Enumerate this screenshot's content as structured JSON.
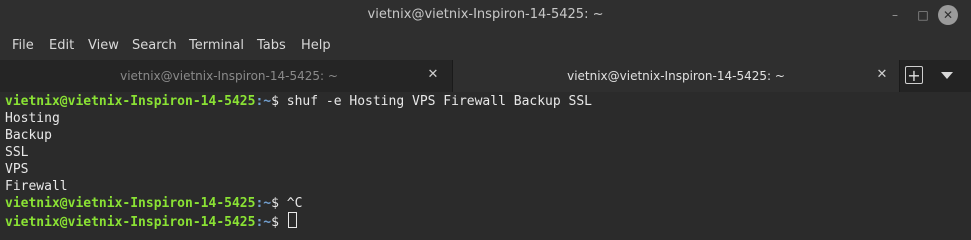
{
  "window": {
    "title": "vietnix@vietnix-Inspiron-14-5425: ~",
    "controls": {
      "minimize": "–",
      "maximize": "□",
      "close": "✕"
    }
  },
  "menu": [
    "File",
    "Edit",
    "View",
    "Search",
    "Terminal",
    "Tabs",
    "Help"
  ],
  "tabs": [
    {
      "label": "vietnix@vietnix-Inspiron-14-5425: ~",
      "active": false
    },
    {
      "label": "vietnix@vietnix-Inspiron-14-5425: ~",
      "active": true
    }
  ],
  "tab_close_glyph": "✕",
  "new_tab_glyph": "+",
  "terminal": {
    "prompt_user": "vietnix@vietnix-Inspiron-14-5425",
    "prompt_path": ":~",
    "prompt_symbol": "$ ",
    "command": "shuf -e Hosting VPS Firewall Backup SSL",
    "output": [
      "Hosting",
      "Backup",
      "SSL",
      "VPS",
      "Firewall"
    ],
    "interrupt": "^C"
  },
  "colors": {
    "background": "#2b2b2b",
    "prompt_user": "#8ae234",
    "prompt_path": "#729fcf",
    "text": "#e8e8e8"
  }
}
